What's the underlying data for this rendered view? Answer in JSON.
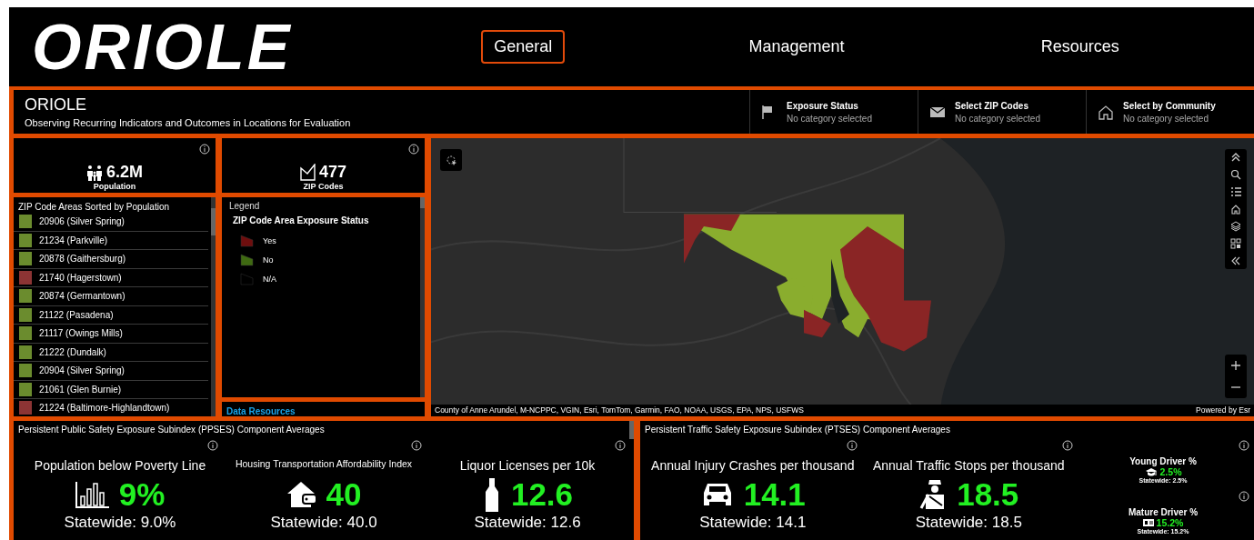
{
  "header": {
    "logo": "ORIOLE",
    "nav": [
      {
        "label": "General",
        "selected": true
      },
      {
        "label": "Management",
        "selected": false
      },
      {
        "label": "Resources",
        "selected": false
      }
    ]
  },
  "title_bar": {
    "title": "ORIOLE",
    "subtitle": "Observing Recurring Indicators and Outcomes in Locations for Evaluation",
    "filters": [
      {
        "label": "Exposure Status",
        "value": "No category selected"
      },
      {
        "label": "Select ZIP Codes",
        "value": "No category selected"
      },
      {
        "label": "Select by Community",
        "value": "No category selected"
      }
    ]
  },
  "kpis": [
    {
      "value": "6.2M",
      "label": "Population"
    },
    {
      "value": "477",
      "label": "ZIP Codes"
    }
  ],
  "zip_list": {
    "title": "ZIP Code Areas Sorted by Population",
    "items": [
      {
        "label": "20906 (Silver Spring)",
        "color": "#6b8c2e"
      },
      {
        "label": "21234 (Parkville)",
        "color": "#6b8c2e"
      },
      {
        "label": "20878 (Gaithersburg)",
        "color": "#6b8c2e"
      },
      {
        "label": "21740 (Hagerstown)",
        "color": "#8c3434"
      },
      {
        "label": "20874 (Germantown)",
        "color": "#6b8c2e"
      },
      {
        "label": "21122 (Pasadena)",
        "color": "#6b8c2e"
      },
      {
        "label": "21117 (Owings Mills)",
        "color": "#6b8c2e"
      },
      {
        "label": "21222 (Dundalk)",
        "color": "#6b8c2e"
      },
      {
        "label": "20904 (Silver Spring)",
        "color": "#6b8c2e"
      },
      {
        "label": "21061 (Glen Burnie)",
        "color": "#6b8c2e"
      },
      {
        "label": "21224 (Baltimore-Highlandtown)",
        "color": "#8c3434"
      }
    ]
  },
  "legend": {
    "heading": "Legend",
    "layer": "ZIP Code Area Exposure Status",
    "items": [
      {
        "label": "Yes",
        "color": "#6e0e0e"
      },
      {
        "label": "No",
        "color": "#3f6a12"
      },
      {
        "label": "N/A",
        "color": "#000000"
      }
    ]
  },
  "data_resources": {
    "link": "Data Resources"
  },
  "map": {
    "kind": "picture",
    "attribution": "County of Anne Arundel, M-NCPPC, VGIN, Esri, TomTom, Garmin, FAO, NOAA, USGS, EPA, NPS, USFWS",
    "powered_by": "Powered by Esr"
  },
  "panels": [
    {
      "title": "Persistent Public Safety Exposure Subindex (PPSES) Component Averages",
      "metrics": [
        {
          "kind": "large",
          "label": "Population below Poverty Line",
          "value": "9%",
          "statewide": "Statewide: 9.0%"
        },
        {
          "kind": "large",
          "label": "Housing Transportation Affordability Index",
          "value": "40",
          "statewide": "Statewide: 40.0"
        },
        {
          "kind": "large",
          "label": "Liquor Licenses per 10k",
          "value": "12.6",
          "statewide": "Statewide: 12.6"
        }
      ]
    },
    {
      "title": "Persistent Traffic Safety Exposure Subindex (PTSES) Component Averages",
      "metrics": [
        {
          "kind": "large",
          "label": "Annual Injury Crashes per thousand",
          "value": "14.1",
          "statewide": "Statewide: 14.1"
        },
        {
          "kind": "large",
          "label": "Annual Traffic Stops per thousand",
          "value": "18.5",
          "statewide": "Statewide: 18.5"
        },
        {
          "kind": "small",
          "label": "Young Driver %",
          "value": "2.5%",
          "statewide": "Statewide: 2.5%"
        },
        {
          "kind": "small",
          "label": "Mature Driver %",
          "value": "15.2%",
          "statewide": "Statewide: 15.2%"
        }
      ]
    }
  ]
}
